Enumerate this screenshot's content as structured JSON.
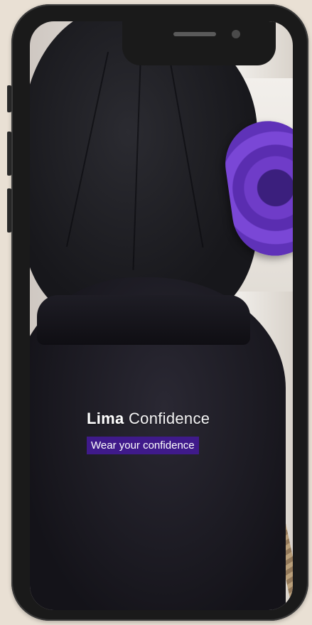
{
  "brand": {
    "name_bold": "Lima",
    "name_light": "Confidence",
    "tagline": "Wear your confidence"
  },
  "colors": {
    "page_background": "#e9e0d4",
    "tagline_background": "#3f1a8a",
    "text": "#ffffff",
    "mat": "#6f3cc8"
  }
}
